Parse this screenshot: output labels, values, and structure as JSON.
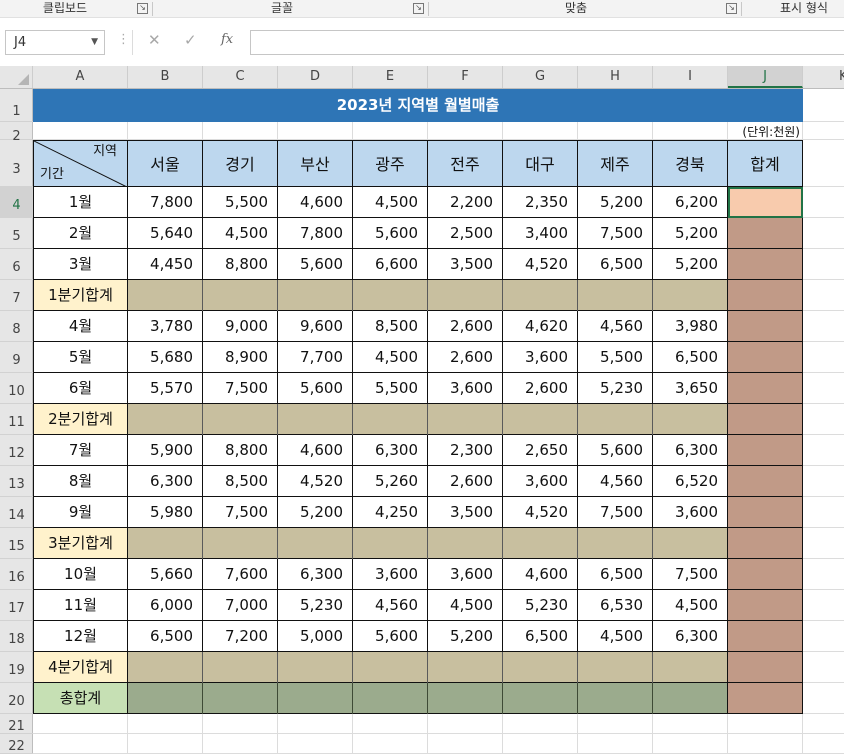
{
  "ribbon": {
    "groups": [
      "클립보드",
      "글꼴",
      "맞춤",
      "표시 형식"
    ],
    "launcher_glyph": "↘"
  },
  "formula_bar": {
    "name_box": "J4",
    "cancel_icon": "✕",
    "enter_icon": "✓",
    "fx_label": "fx",
    "value": ""
  },
  "sheet": {
    "columns": [
      "A",
      "B",
      "C",
      "D",
      "E",
      "F",
      "G",
      "H",
      "I",
      "J",
      "K"
    ],
    "active_column": "J",
    "rows": [
      "1",
      "2",
      "3",
      "4",
      "5",
      "6",
      "7",
      "8",
      "9",
      "10",
      "11",
      "12",
      "13",
      "14",
      "15",
      "16",
      "17",
      "18",
      "19",
      "20",
      "21",
      "22"
    ],
    "active_row": "4",
    "title": "2023년 지역별 월별매출",
    "unit": "(단위:천원)",
    "corner_top": "지역",
    "corner_bottom": "기간",
    "regions": [
      "서울",
      "경기",
      "부산",
      "광주",
      "전주",
      "대구",
      "제주",
      "경북"
    ],
    "total_header": "합계",
    "months": [
      {
        "label": "1월",
        "values": [
          "7,800",
          "5,500",
          "4,600",
          "4,500",
          "2,200",
          "2,350",
          "5,200",
          "6,200"
        ]
      },
      {
        "label": "2월",
        "values": [
          "5,640",
          "4,500",
          "7,800",
          "5,600",
          "2,500",
          "3,400",
          "7,500",
          "5,200"
        ]
      },
      {
        "label": "3월",
        "values": [
          "4,450",
          "8,800",
          "5,600",
          "6,600",
          "3,500",
          "4,520",
          "6,500",
          "5,200"
        ]
      },
      {
        "label": "4월",
        "values": [
          "3,780",
          "9,000",
          "9,600",
          "8,500",
          "2,600",
          "4,620",
          "4,560",
          "3,980"
        ]
      },
      {
        "label": "5월",
        "values": [
          "5,680",
          "8,900",
          "7,700",
          "4,500",
          "2,600",
          "3,600",
          "5,500",
          "6,500"
        ]
      },
      {
        "label": "6월",
        "values": [
          "5,570",
          "7,500",
          "5,600",
          "5,500",
          "3,600",
          "2,600",
          "5,230",
          "3,650"
        ]
      },
      {
        "label": "7월",
        "values": [
          "5,900",
          "8,800",
          "4,600",
          "6,300",
          "2,300",
          "2,650",
          "5,600",
          "6,300"
        ]
      },
      {
        "label": "8월",
        "values": [
          "6,300",
          "8,500",
          "4,520",
          "5,260",
          "2,600",
          "3,600",
          "4,560",
          "6,520"
        ]
      },
      {
        "label": "9월",
        "values": [
          "5,980",
          "7,500",
          "5,200",
          "4,250",
          "3,500",
          "4,520",
          "7,500",
          "3,600"
        ]
      },
      {
        "label": "10월",
        "values": [
          "5,660",
          "7,600",
          "6,300",
          "3,600",
          "3,600",
          "4,600",
          "6,500",
          "7,500"
        ]
      },
      {
        "label": "11월",
        "values": [
          "6,000",
          "7,000",
          "5,230",
          "4,560",
          "4,500",
          "5,230",
          "6,530",
          "4,500"
        ]
      },
      {
        "label": "12월",
        "values": [
          "6,500",
          "7,200",
          "5,000",
          "5,600",
          "5,200",
          "6,500",
          "4,500",
          "6,300"
        ]
      }
    ],
    "quarter_labels": [
      "1분기합계",
      "2분기합계",
      "3분기합계",
      "4분기합계"
    ],
    "grand_total_label": "총합계",
    "colors": {
      "title_bg": "#2e75b6",
      "header_bg": "#bdd7ee",
      "quarter_label_bg": "#fff2cc",
      "quarter_fill": "#c8bf9f",
      "total_label_bg": "#c6e0b4",
      "total_fill": "#9bab8d",
      "total_col_fill": "#c19a87",
      "selected_cell_fill": "#f8cbad",
      "excel_green": "#217346"
    }
  }
}
